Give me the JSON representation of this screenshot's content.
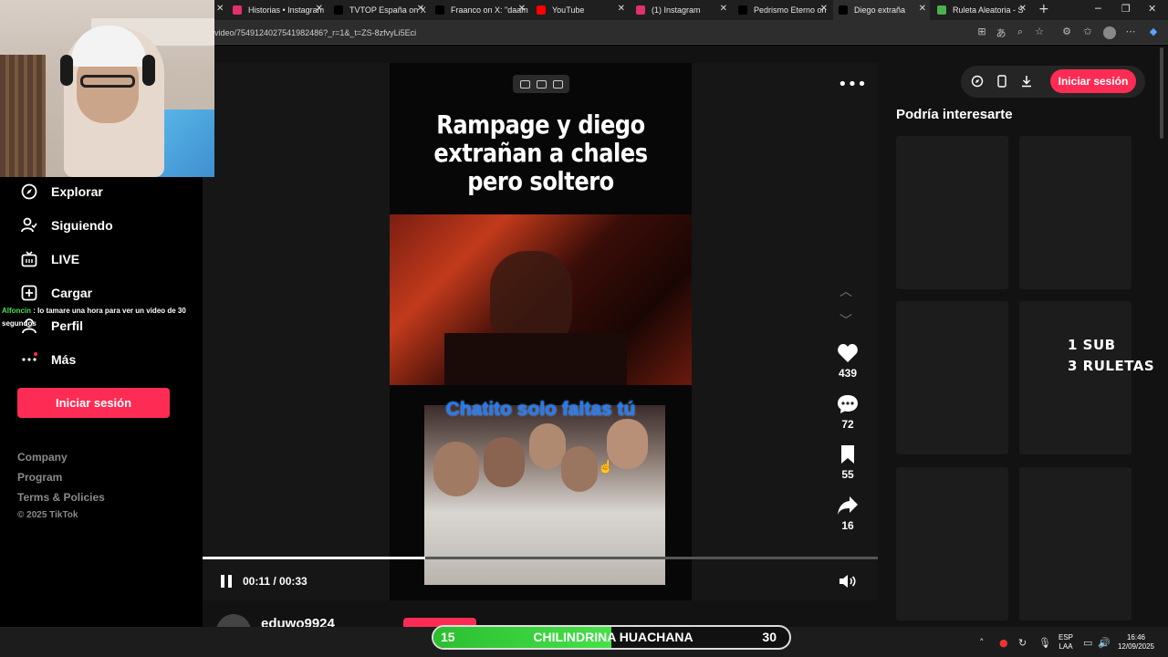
{
  "browser": {
    "tabs": [
      {
        "title": "Historias • Instagram",
        "favicon": "instagram-icon",
        "color": "#e1306c"
      },
      {
        "title": "TVTOP España on X",
        "favicon": "x-icon",
        "color": "#000000"
      },
      {
        "title": "Fraanco on X: \"daam",
        "favicon": "x-icon",
        "color": "#000000"
      },
      {
        "title": "YouTube",
        "favicon": "youtube-icon",
        "color": "#ff0000"
      },
      {
        "title": "(1) Instagram",
        "favicon": "instagram-icon",
        "color": "#e1306c"
      },
      {
        "title": "Pedrismo Eterno on",
        "favicon": "x-icon",
        "color": "#000000"
      },
      {
        "title": "Diego extraña",
        "favicon": "tiktok-icon",
        "color": "#000000",
        "active": true
      },
      {
        "title": "Ruleta Aleatoria - S",
        "favicon": "wheel-icon",
        "color": "#4caf50"
      }
    ],
    "url": "video/7549124027541982486?_r=1&_t=ZS-8zfvyLi5Eci"
  },
  "sidebar": {
    "nav": [
      {
        "label": "Explorar",
        "icon": "compass-icon"
      },
      {
        "label": "Siguiendo",
        "icon": "following-icon"
      },
      {
        "label": "LIVE",
        "icon": "live-tv-icon"
      },
      {
        "label": "Cargar",
        "icon": "upload-icon"
      },
      {
        "label": "Perfil",
        "icon": "profile-icon"
      },
      {
        "label": "Más",
        "icon": "more-icon"
      }
    ],
    "login_label": "Iniciar sesión",
    "footer": [
      "Company",
      "Program",
      "Terms & Policies"
    ],
    "copyright": "© 2025 TikTok"
  },
  "video": {
    "title": "Rampage y diego extrañan a chales pero soltero",
    "caption": "Chatito solo faltas tú",
    "likes": "439",
    "comments": "72",
    "saves": "55",
    "shares": "16",
    "time": "00:11 / 00:33",
    "progress": 0.33,
    "author": "eduwo9924"
  },
  "right": {
    "login_label": "Iniciar sesión",
    "interest_title": "Podría interesarte"
  },
  "overlay": {
    "line1": "1 SUB",
    "line2": "3 RULETAS"
  },
  "chat": {
    "user": "Alfoncin",
    "message": " : lo tamare una hora para ver un video de 30 segundos"
  },
  "roulette": {
    "left": "15",
    "label": "CHILINDRINA HUACHANA",
    "right": "30"
  },
  "taskbar": {
    "lang1": "ESP",
    "lang2": "LAA",
    "time": "16:46",
    "date": "12/09/2025"
  },
  "colors": {
    "accent": "#fe2c55",
    "caption_blue": "#1e7cff",
    "roulette_green": "#46e04a"
  }
}
